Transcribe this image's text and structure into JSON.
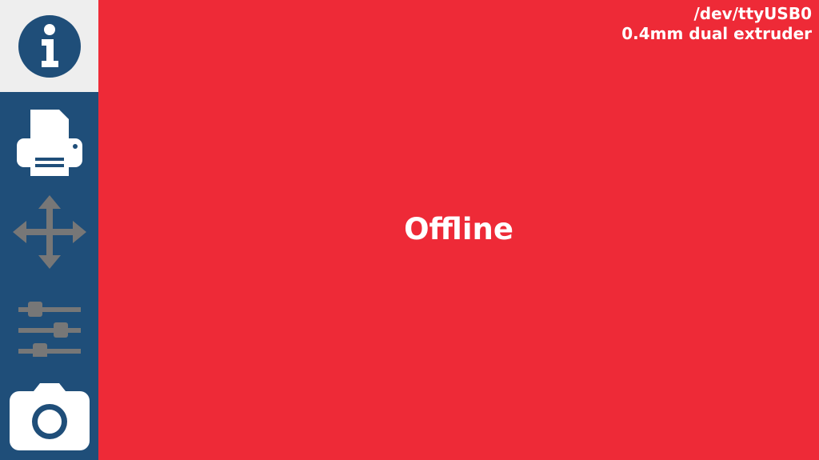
{
  "sidebar": {
    "items": [
      {
        "id": "info",
        "icon": "info-icon",
        "active": true
      },
      {
        "id": "print",
        "icon": "printer-icon",
        "active": false
      },
      {
        "id": "move",
        "icon": "move-arrows-icon",
        "active": false,
        "disabled": true
      },
      {
        "id": "tune",
        "icon": "sliders-icon",
        "active": false,
        "disabled": true
      },
      {
        "id": "camera",
        "icon": "camera-icon",
        "active": false
      }
    ]
  },
  "connection": {
    "port": "/dev/ttyUSB0",
    "profile": "0.4mm dual extruder"
  },
  "status": {
    "text": "Offline"
  },
  "colors": {
    "background": "#ee2a37",
    "sidebar": "#1f4e79",
    "active_tab": "#eeeeee",
    "icon_enabled": "#ffffff",
    "icon_disabled": "#777777"
  }
}
